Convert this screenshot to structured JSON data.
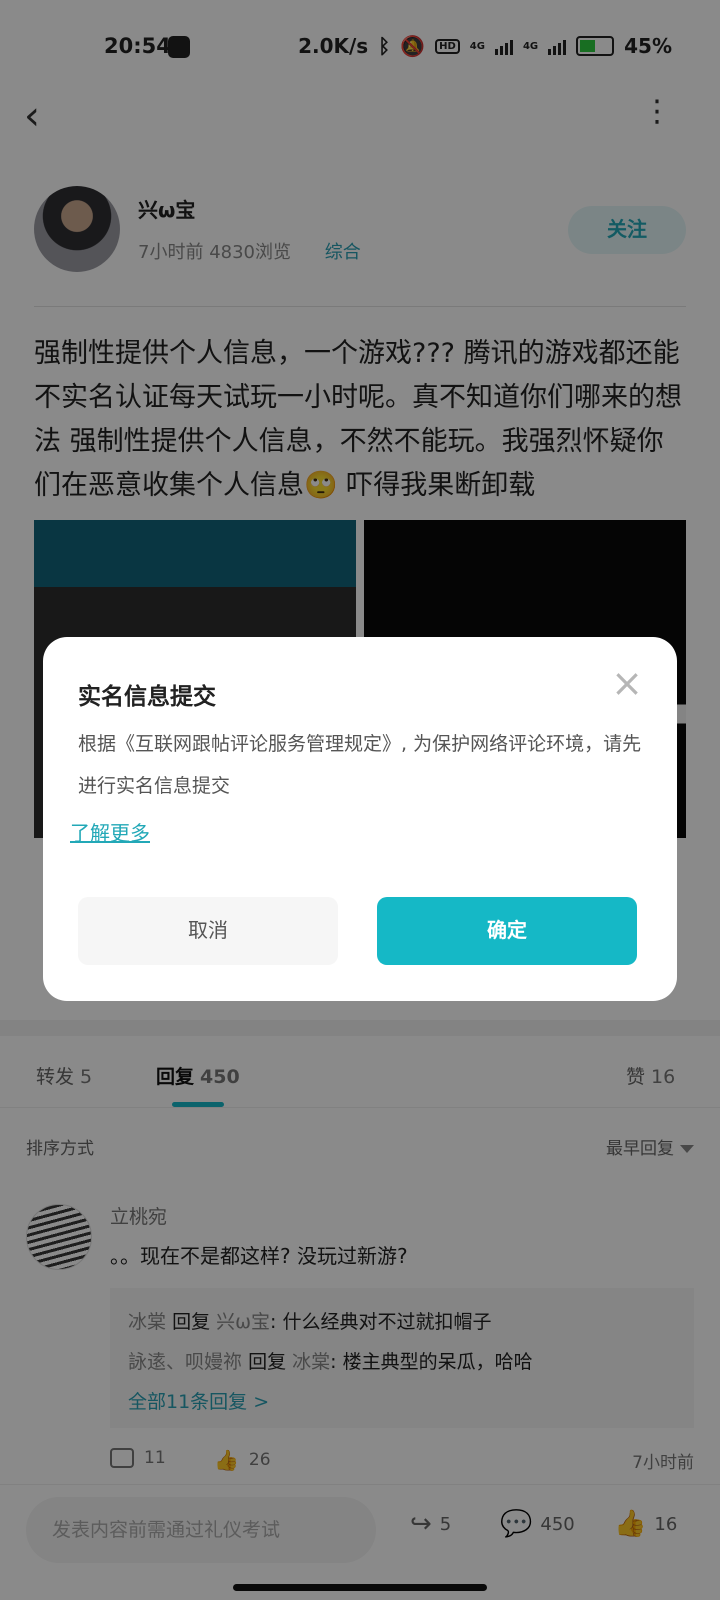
{
  "status_bar": {
    "time": "20:54",
    "net_speed": "2.0K/s",
    "network_1": "4G",
    "network_2": "4G",
    "hd_badge": "HD",
    "battery": "45%"
  },
  "post": {
    "author": {
      "name": "兴ω宝",
      "time_ago": "7小时前",
      "views": "4830浏览",
      "category": "综合"
    },
    "follow_label": "关注",
    "content": "强制性提供个人信息，一个游戏??? 腾讯的游戏都还能不实名认证每天试玩一小时呢。真不知道你们哪来的想法 强制性提供个人信息，不然不能玩。我强烈怀疑你们在恶意收集个人信息🙄 吓得我果断卸载"
  },
  "tabs": [
    {
      "label": "转发",
      "count": "5"
    },
    {
      "label": "回复",
      "count": "450"
    },
    {
      "label": "赞",
      "count": "16"
    }
  ],
  "sort": {
    "label": "排序方式",
    "value": "最早回复"
  },
  "comment": {
    "name": "立桃宛",
    "text": "。。现在不是都这样? 没玩过新游?",
    "replies": [
      {
        "from": "冰棠",
        "verb": "回复",
        "to": "兴ω宝",
        "text": ": 什么经典对不过就扣帽子"
      },
      {
        "from": "詠逺、呗嫚祢",
        "verb": "回复",
        "to": "冰棠",
        "text": ": 楼主典型的呆瓜，哈哈"
      }
    ],
    "more_replies": "全部11条回复 >",
    "reply_count": "11",
    "like_count": "26",
    "time": "7小时前"
  },
  "bottom_bar": {
    "input_placeholder": "发表内容前需通过礼仪考试",
    "share_count": "5",
    "comment_count": "450",
    "like_count": "16"
  },
  "dialog": {
    "title": "实名信息提交",
    "body": "根据《互联网跟帖评论服务管理规定》, 为保护网络评论环境，请先进行实名信息提交",
    "link": "了解更多",
    "cancel": "取消",
    "confirm": "确定"
  },
  "colors": {
    "accent": "#15b8c6",
    "link": "#22a8b7",
    "overlay": "#000000"
  }
}
